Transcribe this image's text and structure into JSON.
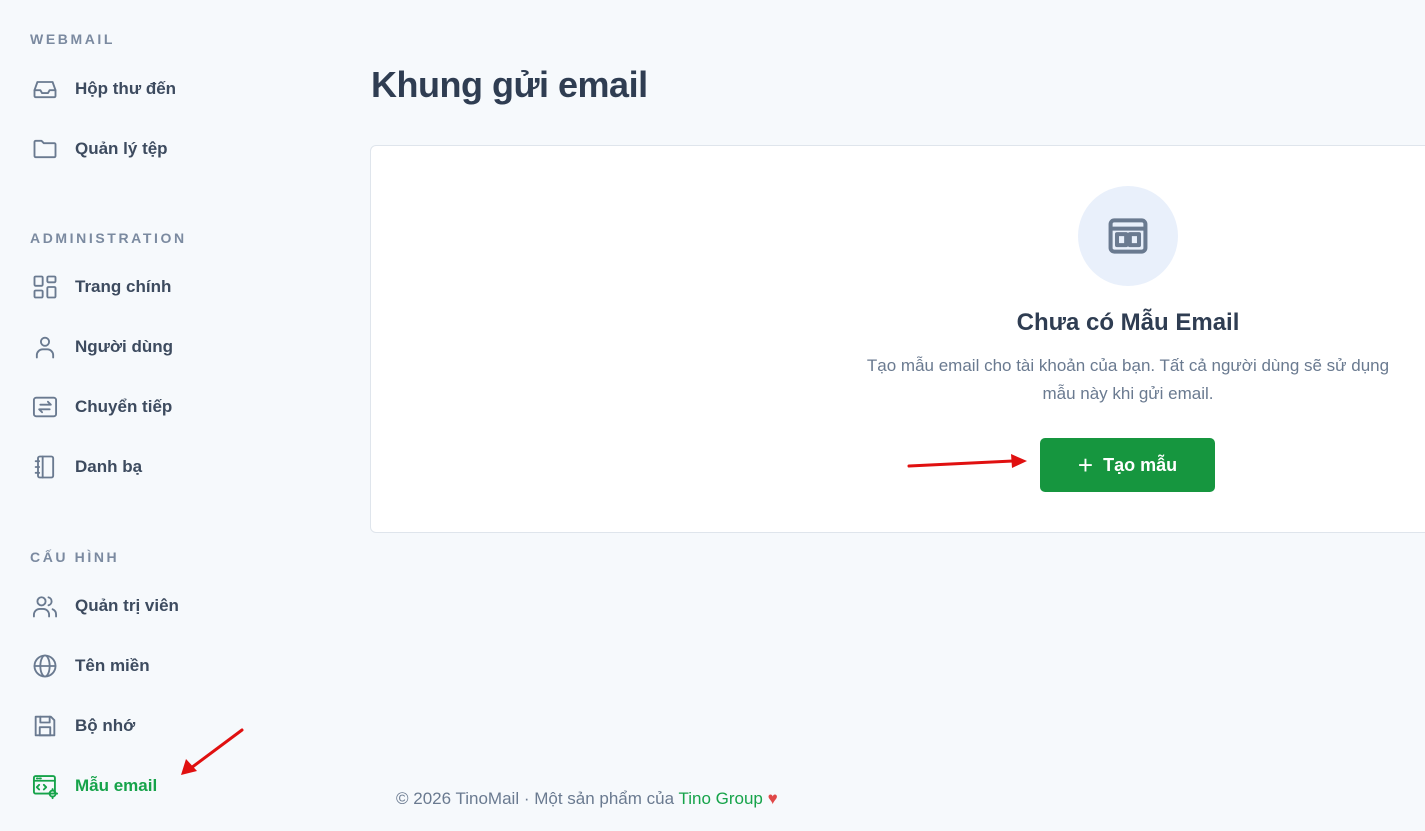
{
  "sidebar": {
    "sections": {
      "webmail": "WEBMAIL",
      "administration": "ADMINISTRATION",
      "config": "CẤU HÌNH"
    },
    "items": {
      "inbox": "Hộp thư đến",
      "files": "Quản lý tệp",
      "home": "Trang chính",
      "users": "Người dùng",
      "forwarding": "Chuyển tiếp",
      "contacts": "Danh bạ",
      "admins": "Quản trị viên",
      "domains": "Tên miền",
      "storage": "Bộ nhớ",
      "templates": "Mẫu email"
    }
  },
  "main": {
    "title": "Khung gửi email",
    "empty_state": {
      "title": "Chưa có Mẫu Email",
      "description_line1": "Tạo mẫu email cho tài khoản của bạn. Tất cả người dùng sẽ sử dụng",
      "description_line2": "mẫu này khi gửi email.",
      "button_label": "Tạo mẫu",
      "button_icon": "+"
    }
  },
  "footer": {
    "text": "© 2026 TinoMail · Một sản phẩm của ",
    "brand": "Tino Group",
    "heart": "♥"
  },
  "colors": {
    "accent": "#16a34a",
    "button": "#16963f",
    "annotation_arrow": "#e01010"
  }
}
